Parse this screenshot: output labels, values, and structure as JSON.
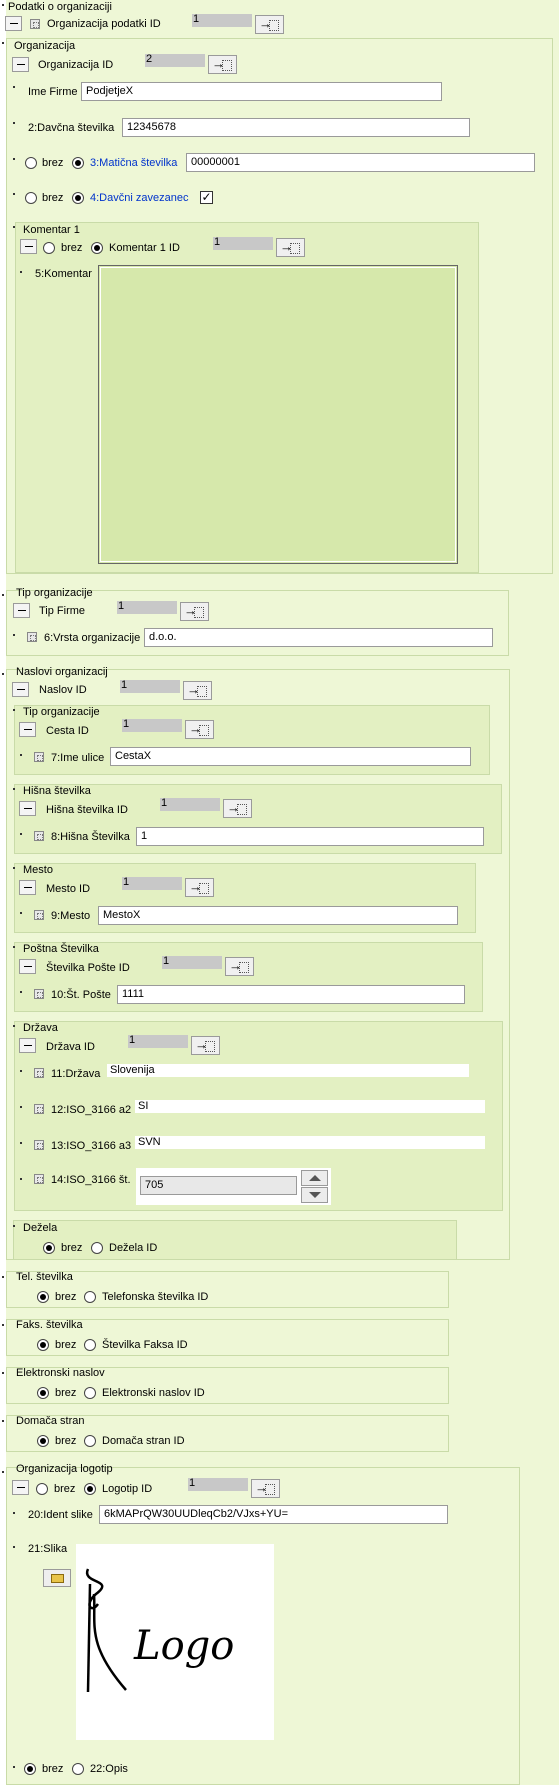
{
  "top": {
    "title": "Podatki o organizaciji",
    "id_label": "Organizacija podatki ID",
    "id_value": "1"
  },
  "org": {
    "title": "Organizacija",
    "id_label": "Organizacija ID",
    "id_value": "2",
    "ime_label": "Ime Firme",
    "ime_value": "PodjetjeX",
    "davcna_label": "2:Davčna številka",
    "davcna_value": "12345678",
    "brez": "brez",
    "maticna_label": "3:Matična številka",
    "maticna_value": "00000001",
    "zavezanec_label": "4:Davčni zavezanec",
    "zavezanec_check": "✓"
  },
  "komentar": {
    "title": "Komentar 1",
    "brez": "brez",
    "id_label": "Komentar 1 ID",
    "id_value": "1",
    "field_label": "5:Komentar",
    "field_value": ""
  },
  "tip": {
    "title": "Tip organizacije",
    "id_label": "Tip Firme",
    "id_value": "1",
    "field_label": "6:Vrsta organizacije",
    "field_value": "d.o.o."
  },
  "naslovi": {
    "title": "Naslovi organizacij",
    "id_label": "Naslov ID",
    "id_value": "1"
  },
  "cesta": {
    "title": "Tip organizacije",
    "id_label": "Cesta ID",
    "id_value": "1",
    "field_label": "7:Ime ulice",
    "field_value": "CestaX"
  },
  "hisna": {
    "title": "Hišna številka",
    "id_label": "Hišna številka ID",
    "id_value": "1",
    "field_label": "8:Hišna Številka",
    "field_value": "1"
  },
  "mesto": {
    "title": "Mesto",
    "id_label": "Mesto ID",
    "id_value": "1",
    "field_label": "9:Mesto",
    "field_value": "MestoX"
  },
  "posta": {
    "title": "Poštna Številka",
    "id_label": "Številka Pošte ID",
    "id_value": "1",
    "field_label": "10:Št. Pošte",
    "field_value": "1111"
  },
  "drzava": {
    "title": "Država",
    "id_label": "Država ID",
    "id_value": "1",
    "f11_label": "11:Država",
    "f11_value": "Slovenija",
    "f12_label": "12:ISO_3166 a2",
    "f12_value": "SI",
    "f13_label": "13:ISO_3166 a3",
    "f13_value": "SVN",
    "f14_label": "14:ISO_3166 št.",
    "f14_value": "705"
  },
  "dezela": {
    "title": "Dežela",
    "brez": "brez",
    "id_label": "Dežela ID"
  },
  "tel": {
    "title": "Tel. številka",
    "brez": "brez",
    "id_label": "Telefonska številka ID"
  },
  "faks": {
    "title": "Faks. številka",
    "brez": "brez",
    "id_label": "Številka Faksa ID"
  },
  "email": {
    "title": "Elektronski naslov",
    "brez": "brez",
    "id_label": "Elektronski naslov ID"
  },
  "domaca": {
    "title": "Domača stran",
    "brez": "brez",
    "id_label": "Domača stran ID"
  },
  "logotip": {
    "title": "Organizacija logotip",
    "brez": "brez",
    "id_label": "Logotip ID",
    "id_value": "1",
    "ident_label": "20:Ident slike",
    "ident_value": "6kMAPrQW30UUDleqCb2/VJxs+YU=",
    "slika_label": "21:Slika",
    "logo_text": "Logo",
    "opis_brez": "brez",
    "opis_label": "22:Opis"
  },
  "icons": {
    "minus": "minus-icon",
    "grid": "grid-icon",
    "arrow": "arrow-right-icon",
    "folder": "folder-icon"
  }
}
